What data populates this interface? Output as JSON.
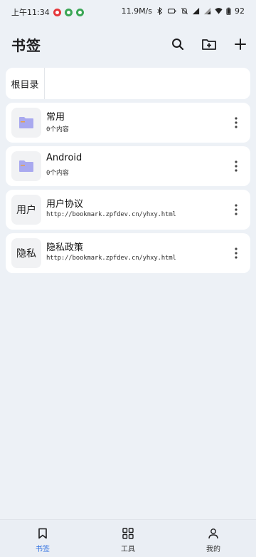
{
  "status": {
    "time": "上午11:34",
    "speed": "11.9M/s",
    "battery": "92"
  },
  "header": {
    "title": "书签"
  },
  "root": {
    "label": "根目录"
  },
  "bookmarks": [
    {
      "thumb": "",
      "icon": "folder-icon",
      "title": "常用",
      "sub": "0个内容"
    },
    {
      "thumb": "",
      "icon": "folder-icon",
      "title": "Android",
      "sub": "0个内容"
    },
    {
      "thumb": "用户",
      "title": "用户协议",
      "sub": "http://bookmark.zpfdev.cn/yhxy.html"
    },
    {
      "thumb": "隐私",
      "title": "隐私政策",
      "sub": "http://bookmark.zpfdev.cn/yhxy.html"
    }
  ],
  "nav": {
    "items": [
      {
        "label": "书签",
        "icon": "bookmark-icon",
        "active": true
      },
      {
        "label": "工具",
        "icon": "grid-icon",
        "active": false
      },
      {
        "label": "我的",
        "icon": "person-icon",
        "active": false
      }
    ]
  },
  "colors": {
    "background": "#edf1f6",
    "card": "#ffffff",
    "accent": "#2f6fe0",
    "folder": "#a9a9ef"
  }
}
